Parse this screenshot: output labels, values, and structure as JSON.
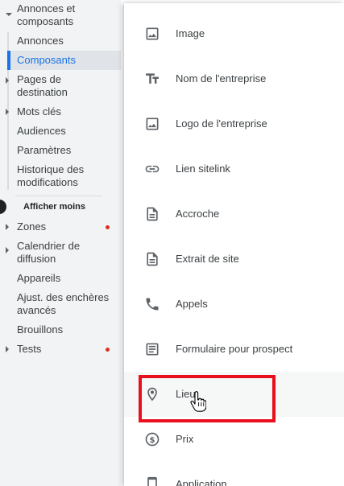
{
  "sidebar": {
    "items": [
      {
        "label": "Annonces et composants",
        "expanded": true
      },
      {
        "label": "Annonces"
      },
      {
        "label": "Composants",
        "selected": true
      },
      {
        "label": "Pages de destination"
      },
      {
        "label": "Mots clés"
      },
      {
        "label": "Audiences"
      },
      {
        "label": "Paramètres"
      },
      {
        "label": "Historique des modifications"
      }
    ],
    "show_less": "Afficher moins",
    "more_items": [
      {
        "label": "Zones",
        "badge": "red-dot"
      },
      {
        "label": "Calendrier de diffusion"
      },
      {
        "label": "Appareils"
      },
      {
        "label": "Ajust. des enchères avancés"
      },
      {
        "label": "Brouillons"
      },
      {
        "label": "Tests",
        "badge": "red-dot"
      }
    ]
  },
  "menu": {
    "items": [
      {
        "label": "Image",
        "icon": "image-icon"
      },
      {
        "label": "Nom de l'entreprise",
        "icon": "text-fields-icon"
      },
      {
        "label": "Logo de l'entreprise",
        "icon": "image-icon"
      },
      {
        "label": "Lien sitelink",
        "icon": "link-icon"
      },
      {
        "label": "Accroche",
        "icon": "description-icon"
      },
      {
        "label": "Extrait de site",
        "icon": "description-icon"
      },
      {
        "label": "Appels",
        "icon": "phone-icon"
      },
      {
        "label": "Formulaire pour prospect",
        "icon": "form-icon"
      },
      {
        "label": "Lieu",
        "icon": "location-pin-icon",
        "hovered": true
      },
      {
        "label": "Prix",
        "icon": "price-icon"
      },
      {
        "label": "Application",
        "icon": "phone-device-icon"
      }
    ]
  },
  "colors": {
    "accent": "#1a73e8",
    "highlight": "#e8101c",
    "badge": "#d93025",
    "icon": "#5f6368"
  }
}
